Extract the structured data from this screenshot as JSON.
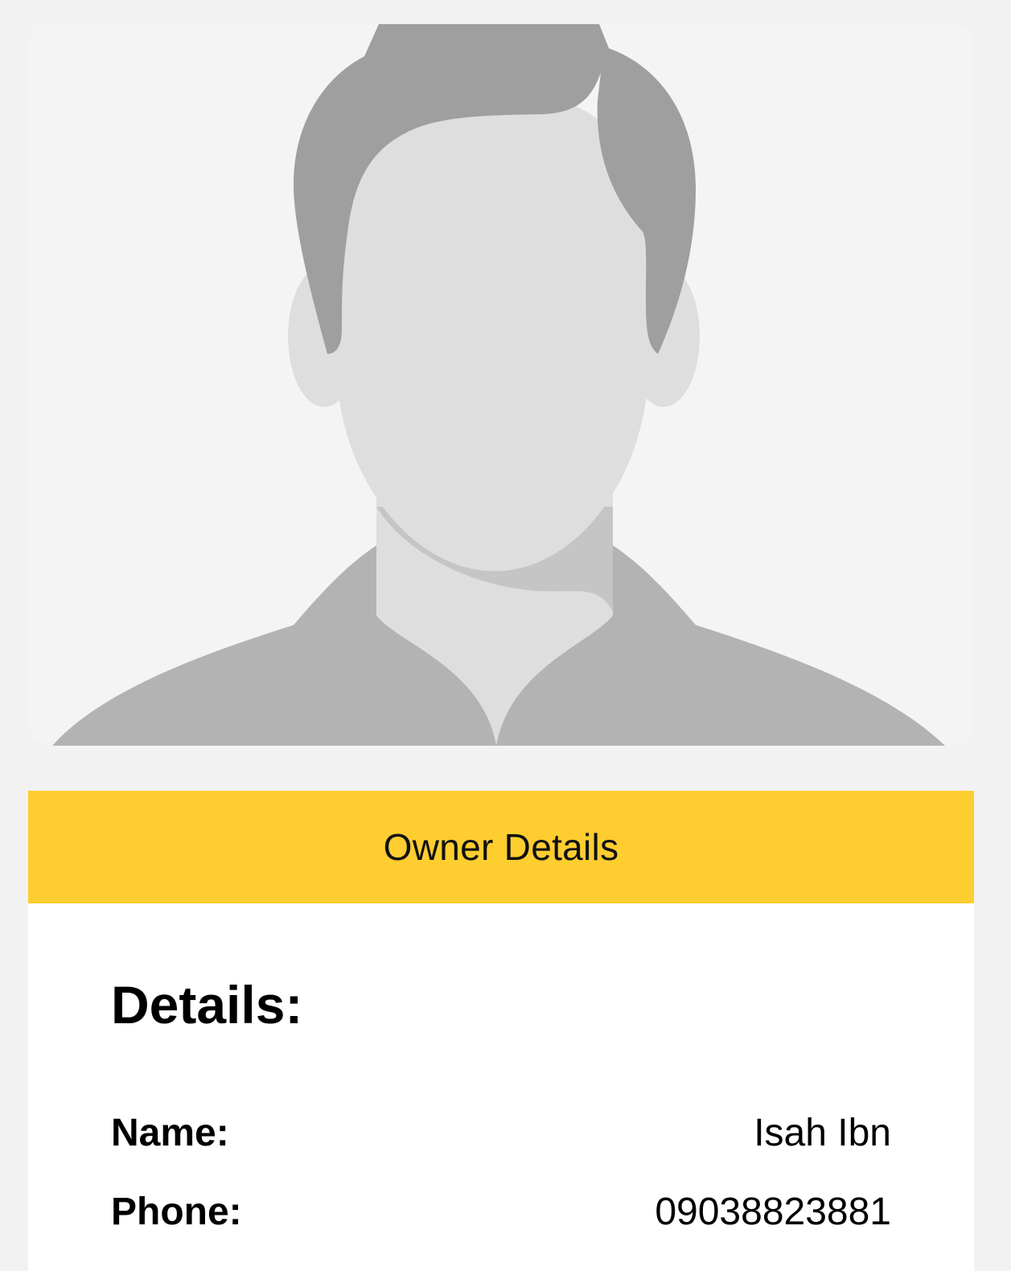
{
  "banner": {
    "title": "Owner Details"
  },
  "details": {
    "heading": "Details:",
    "rows": [
      {
        "label": "Name:",
        "value": "Isah Ibn"
      },
      {
        "label": "Phone:",
        "value": "09038823881"
      }
    ]
  },
  "avatar": {
    "icon": "person-silhouette-icon"
  },
  "colors": {
    "page_background": "#f2f2f2",
    "avatar_background": "#f4f4f4",
    "banner": "#fecd30",
    "panel": "#ffffff",
    "hair": "#9f9f9f",
    "skin": "#dedede",
    "neck_shadow": "#c6c5c5",
    "shirt": "#b3b3b3"
  }
}
